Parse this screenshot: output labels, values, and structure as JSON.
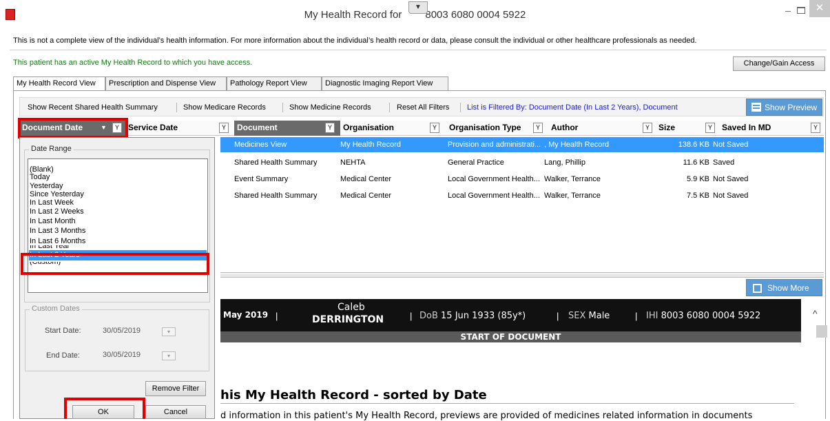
{
  "window": {
    "title": "My Health Record for",
    "title_ihi": "8003 6080 0004 5922",
    "title_dropdown_glyph": "▼",
    "controls": {
      "minimize": "–",
      "close": "✕"
    }
  },
  "notice": "This is not a complete view of the individual’s health information. For more information about the individual’s health record or data, please consult the individual or other healthcare professionals as needed.",
  "access": {
    "text": "This patient has an active My Health Record to which you have access.",
    "button": "Change/Gain Access"
  },
  "tabs": [
    {
      "label": "My Health Record View",
      "active": true
    },
    {
      "label": "Prescription and Dispense View",
      "active": false
    },
    {
      "label": "Pathology Report View",
      "active": false
    },
    {
      "label": "Diagnostic Imaging Report View",
      "active": false
    }
  ],
  "toolbar": {
    "items": [
      "Show Recent Shared Health Summary",
      "Show Medicare Records",
      "Show Medicine Records",
      "Reset All Filters"
    ],
    "filter_status": "List is Filtered By: Document Date (In Last 2 Years), Document",
    "show_preview": "Show Preview"
  },
  "columns": [
    "Document Date",
    "Service Date",
    "Document",
    "Organisation",
    "Organisation Type",
    "Author",
    "Size",
    "Saved In MD"
  ],
  "rows": [
    {
      "document": "Medicines View",
      "organisation": "My Health Record",
      "org_type": "Provision and administrati...",
      "author": ", My Health Record",
      "size": "138.6 KB",
      "saved": "Not Saved",
      "selected": true
    },
    {
      "document": "Shared Health Summary",
      "organisation": "NEHTA",
      "org_type": "General Practice",
      "author": "Lang, Phillip",
      "size": "11.6 KB",
      "saved": "Saved",
      "selected": false
    },
    {
      "document": "Event Summary",
      "organisation": "Medical Center",
      "org_type": "Local Government Health...",
      "author": "Walker, Terrance",
      "size": "5.9 KB",
      "saved": "Not Saved",
      "selected": false
    },
    {
      "document": "Shared Health Summary",
      "organisation": "Medical Center",
      "org_type": "Local Government Health...",
      "author": "Walker, Terrance",
      "size": "7.5 KB",
      "saved": "Not Saved",
      "selected": false
    }
  ],
  "filter_panel": {
    "date_range_legend": "Date Range",
    "options": [
      "(Blank)",
      "Today",
      "Yesterday",
      "Since Yesterday",
      "In Last Week",
      "In Last 2 Weeks",
      "In Last Month",
      "In Last 3 Months",
      "In Last 6 Months"
    ],
    "clipped_option_above": "In Last Year",
    "selected_option": "In Last 2 Years",
    "clipped_option_below": "(Custom)",
    "custom_dates_legend": "Custom Dates",
    "start_label": "Start Date:",
    "start_value": "30/05/2019",
    "end_label": "End Date:",
    "end_value": "30/05/2019",
    "remove_filter": "Remove Filter",
    "ok": "OK",
    "cancel": "Cancel"
  },
  "show_more": "Show More",
  "document_view": {
    "date_fragment": "May 2019",
    "sep": "|",
    "first_name": "Caleb",
    "last_name": "DERRINGTON",
    "dob_label": "DoB",
    "dob_value": "15 Jun 1933 (85y*)",
    "sex_label": "SEX",
    "sex_value": "Male",
    "ihi_label": "IHI",
    "ihi_value": "8003 6080 0004 5922",
    "start_label": "START OF DOCUMENT",
    "heading": "his My Health Record - sorted by Date",
    "paragraph": "d information in this patient's My Health Record, previews are provided of medicines related information in documents"
  },
  "colors": {
    "accent": "#3399ff",
    "highlight": "#e00000",
    "button_blue": "#5b9bd5",
    "access_green": "#0a7d0a",
    "filter_blue": "#1a1ad8"
  }
}
